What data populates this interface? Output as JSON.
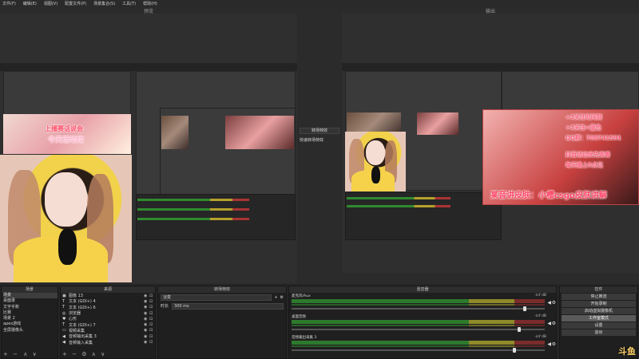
{
  "menu": [
    "文件(F)",
    "编辑(E)",
    "视图(V)",
    "配置文件(P)",
    "场景集合(S)",
    "工具(T)",
    "帮助(H)"
  ],
  "preview_title": "预览",
  "program_title": "输出",
  "mid_controls": {
    "transition_label": "转场特效",
    "quick_label": "快速转场特效"
  },
  "overlay": {
    "preview_banner_top": "上播赛话说会",
    "preview_banner_mid": "今天活动纹",
    "program_caption": "某音讲皮肤：小樱csgo皮肤讲解",
    "program_lines": [
      "+3关注时间到",
      "+3关注=蓝色",
      "QQ群：706741591",
      "抖音活动优先观看",
      "每天晚上8点见"
    ]
  },
  "docks": {
    "scenes": {
      "title": "场景",
      "items": [
        "场景",
        "桌面录",
        "文字手账",
        "比赛",
        "场景 2",
        "apex游戏",
        "全屏摄像头"
      ],
      "selected": 0
    },
    "sources": {
      "title": "来源",
      "items": [
        {
          "icon": "image",
          "label": "图像 13"
        },
        {
          "icon": "text",
          "label": "文本 (GDI+) 4"
        },
        {
          "icon": "text",
          "label": "文本 (GDI+) 6"
        },
        {
          "icon": "browser",
          "label": "浏览器"
        },
        {
          "icon": "heart",
          "label": "心形"
        },
        {
          "icon": "text",
          "label": "文本 (GDI+) 7"
        },
        {
          "icon": "camera",
          "label": "视频采集"
        },
        {
          "icon": "audio",
          "label": "音频输出采集 3"
        },
        {
          "icon": "audio",
          "label": "音频输入采集"
        }
      ]
    },
    "transitions": {
      "title": "转场特效",
      "type": "淡变",
      "duration_label": "时长",
      "duration_value": "300 ms"
    },
    "mixer": {
      "title": "混音器",
      "channels": [
        {
          "name": "麦克风/Aux",
          "db": "-inf dB",
          "volume": 0.92
        },
        {
          "name": "桌面音频",
          "db": "-inf dB",
          "volume": 0.9
        },
        {
          "name": "音频输出采集 3",
          "db": "-inf dB",
          "volume": 0.88
        }
      ]
    },
    "controls": {
      "title": "控件",
      "buttons": [
        "停止推流",
        "开始录制",
        "启动虚拟摄像机",
        "工作室模式",
        "设置",
        "退出"
      ],
      "active": 3
    }
  },
  "watermark": "斗鱼"
}
